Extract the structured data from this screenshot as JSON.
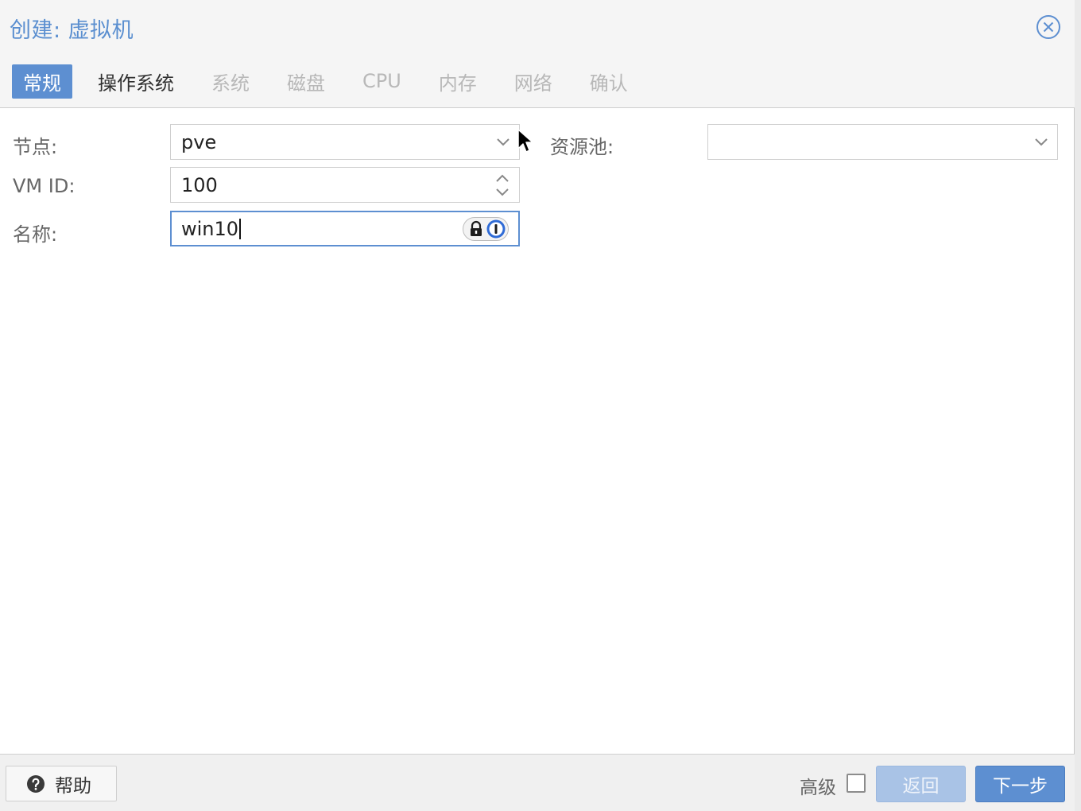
{
  "dialog": {
    "title": "创建: 虚拟机"
  },
  "tabs": [
    {
      "label": "常规",
      "state": "active"
    },
    {
      "label": "操作系统",
      "state": "enabled"
    },
    {
      "label": "系统",
      "state": "disabled"
    },
    {
      "label": "磁盘",
      "state": "disabled"
    },
    {
      "label": "CPU",
      "state": "disabled"
    },
    {
      "label": "内存",
      "state": "disabled"
    },
    {
      "label": "网络",
      "state": "disabled"
    },
    {
      "label": "确认",
      "state": "disabled"
    }
  ],
  "form": {
    "node": {
      "label": "节点:",
      "value": "pve",
      "icon": "chevron-down-icon"
    },
    "vmid": {
      "label": "VM ID:",
      "value": "100",
      "icon": "spinner-icon"
    },
    "name": {
      "label": "名称:",
      "value": "win10",
      "icon": "password-manager-icon"
    },
    "pool": {
      "label": "资源池:",
      "value": "",
      "icon": "chevron-down-icon"
    }
  },
  "footer": {
    "help_label": "帮助",
    "advanced_label": "高级",
    "advanced_checked": false,
    "back_label": "返回",
    "next_label": "下一步"
  },
  "colors": {
    "accent": "#5d8fd1",
    "title": "#5b8fd0",
    "disabled_tab": "#b8b8b8",
    "back_disabled": "#a9c3e6"
  }
}
